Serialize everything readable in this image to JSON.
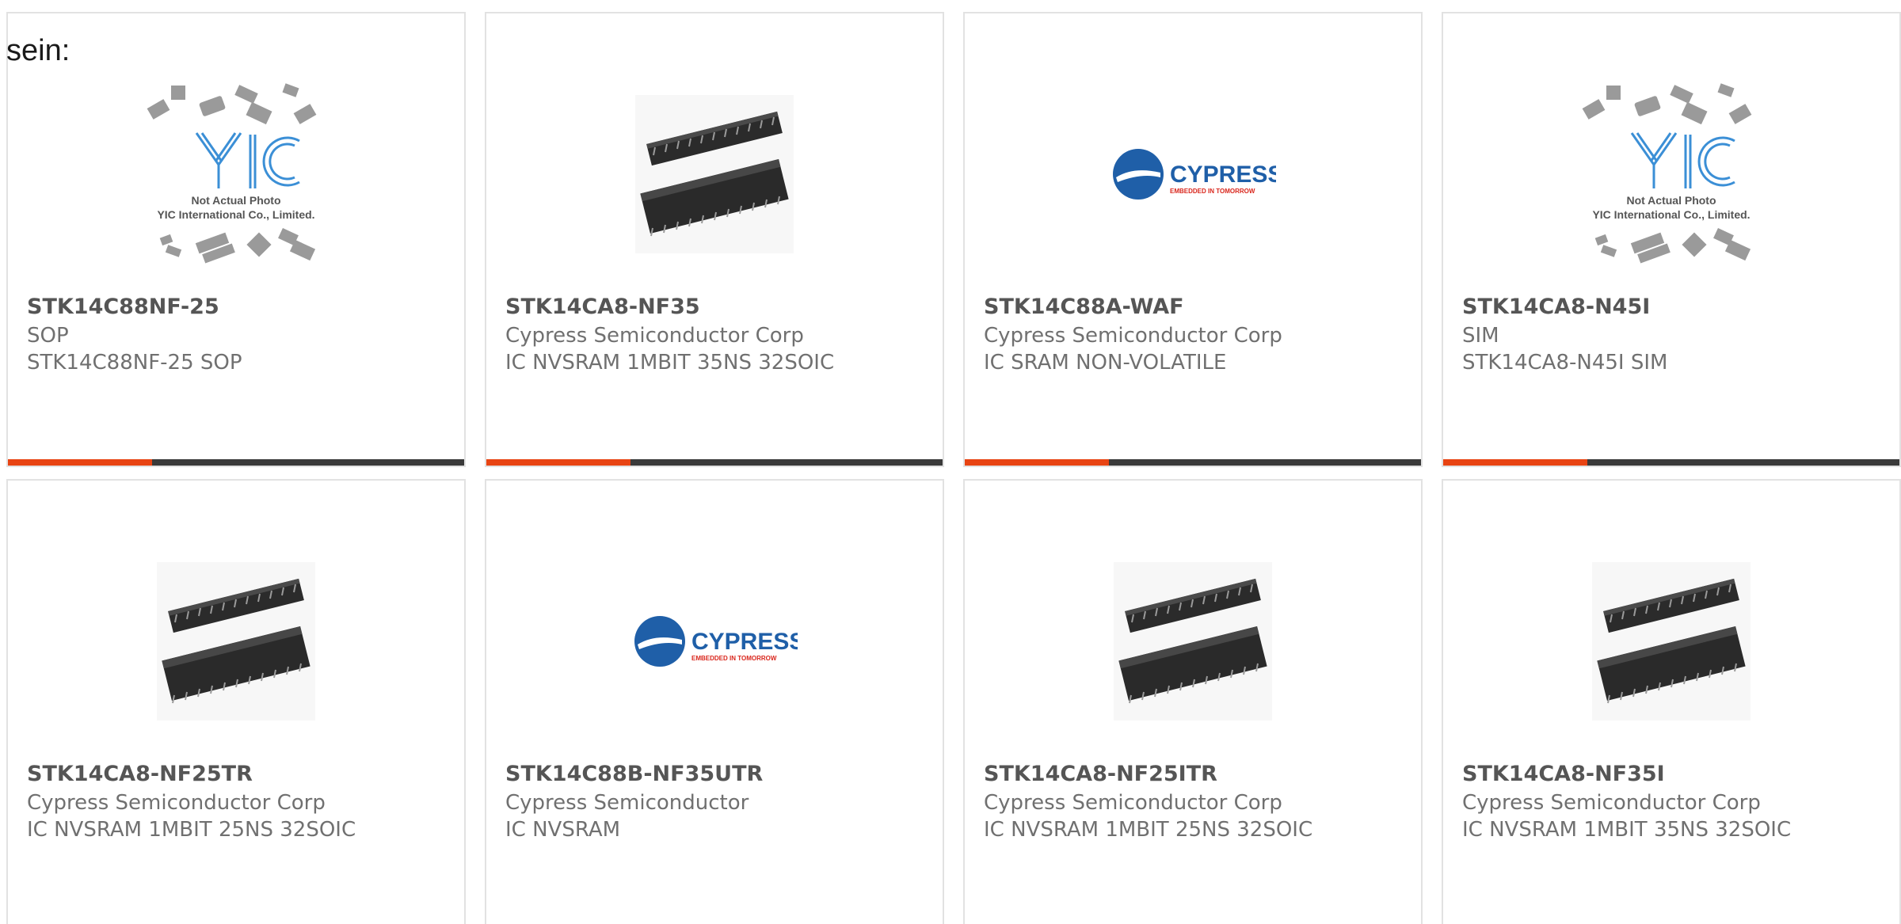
{
  "intro_text": "sein:",
  "colors": {
    "accent": "#e84413",
    "bar": "#3a3a3a",
    "border": "#e2e2e2",
    "cypress_blue": "#1f5fa8",
    "cypress_red": "#d9261c"
  },
  "products": [
    {
      "part": "STK14C88NF-25",
      "line1": "SOP",
      "line2": "STK14C88NF-25 SOP",
      "image": "yic-placeholder",
      "placeholder": {
        "l1": "Not Actual Photo",
        "l2": "YIC International Co., Limited."
      }
    },
    {
      "part": "STK14CA8-NF35",
      "line1": "Cypress Semiconductor Corp",
      "line2": "IC NVSRAM 1MBIT 35NS 32SOIC",
      "image": "soic-chip-photo"
    },
    {
      "part": "STK14C88A-WAF",
      "line1": "Cypress Semiconductor Corp",
      "line2": "IC SRAM NON-VOLATILE",
      "image": "cypress-logo",
      "logo": {
        "name": "CYPRESS",
        "tagline": "EMBEDDED IN TOMORROW"
      }
    },
    {
      "part": "STK14CA8-N45I",
      "line1": "SIM",
      "line2": "STK14CA8-N45I SIM",
      "image": "yic-placeholder",
      "placeholder": {
        "l1": "Not Actual Photo",
        "l2": "YIC International Co., Limited."
      }
    },
    {
      "part": "STK14CA8-NF25TR",
      "line1": "Cypress Semiconductor Corp",
      "line2": "IC NVSRAM 1MBIT 25NS 32SOIC",
      "image": "soic-chip-photo"
    },
    {
      "part": "STK14C88B-NF35UTR",
      "line1": "Cypress Semiconductor",
      "line2": "IC NVSRAM",
      "image": "cypress-logo",
      "logo": {
        "name": "CYPRESS",
        "tagline": "EMBEDDED IN TOMORROW"
      }
    },
    {
      "part": "STK14CA8-NF25ITR",
      "line1": "Cypress Semiconductor Corp",
      "line2": "IC NVSRAM 1MBIT 25NS 32SOIC",
      "image": "soic-chip-photo"
    },
    {
      "part": "STK14CA8-NF35I",
      "line1": "Cypress Semiconductor Corp",
      "line2": "IC NVSRAM 1MBIT 35NS 32SOIC",
      "image": "soic-chip-photo"
    }
  ]
}
